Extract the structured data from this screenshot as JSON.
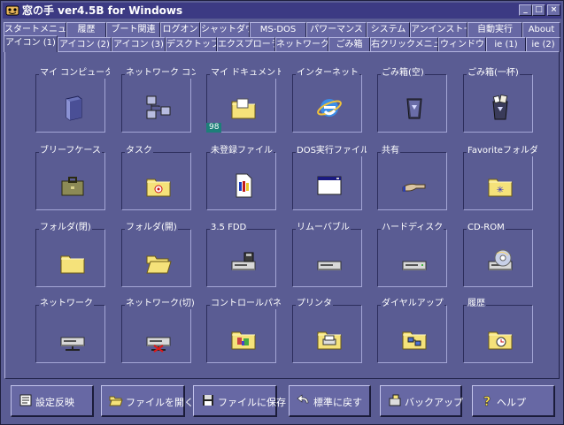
{
  "window": {
    "title": "窓の手 ver4.5B for Windows",
    "controls": [
      "_",
      "□",
      "×"
    ]
  },
  "tabs_row1": [
    "スタートメニュー",
    "履歴",
    "ブート関連",
    "ログオン",
    "シャットダウン",
    "MS-DOS",
    "パワーマンス",
    "システム",
    "アンインストール",
    "自動実行",
    "About"
  ],
  "tabs_row2": [
    "アイコン (1)",
    "アイコン (2)",
    "アイコン (3)",
    "デスクトップ",
    "エクスプローラ",
    "ネットワーク",
    "ごみ箱",
    "右クリックメニュー",
    "ウィンドウ",
    "ie (1)",
    "ie (2)"
  ],
  "active_tab": "アイコン (1)",
  "icons": [
    {
      "label": "マイ コンピュータ",
      "icon": "my-computer-icon"
    },
    {
      "label": "ネットワーク コンピュ",
      "icon": "network-computers-icon"
    },
    {
      "label": "マイ ドキュメント",
      "icon": "my-documents-icon",
      "badge": "98"
    },
    {
      "label": "インターネット",
      "icon": "internet-explorer-icon"
    },
    {
      "label": "ごみ箱(空)",
      "icon": "recycle-bin-empty-icon"
    },
    {
      "label": "ごみ箱(一杯)",
      "icon": "recycle-bin-full-icon"
    },
    {
      "label": "ブリーフケース",
      "icon": "briefcase-icon"
    },
    {
      "label": "タスク",
      "icon": "task-folder-icon"
    },
    {
      "label": "未登録ファイル",
      "icon": "unregistered-file-icon"
    },
    {
      "label": "DOS実行ファイル",
      "icon": "dos-executable-icon"
    },
    {
      "label": "共有",
      "icon": "shared-hand-icon"
    },
    {
      "label": "Favoriteフォルダ",
      "icon": "favorite-folder-icon"
    },
    {
      "label": "フォルダ(閉)",
      "icon": "folder-closed-icon"
    },
    {
      "label": "フォルダ(開)",
      "icon": "folder-open-icon"
    },
    {
      "label": "3.5 FDD",
      "icon": "floppy-drive-icon"
    },
    {
      "label": "リムーバブル",
      "icon": "removable-drive-icon"
    },
    {
      "label": "ハードディスク",
      "icon": "hard-disk-icon"
    },
    {
      "label": "CD-ROM",
      "icon": "cdrom-icon"
    },
    {
      "label": "ネットワーク",
      "icon": "network-drive-icon"
    },
    {
      "label": "ネットワーク(切)",
      "icon": "network-drive-disconnected-icon"
    },
    {
      "label": "コントロールパネル",
      "icon": "control-panel-icon"
    },
    {
      "label": "プリンタ",
      "icon": "printers-folder-icon"
    },
    {
      "label": "ダイヤルアップ",
      "icon": "dialup-folder-icon"
    },
    {
      "label": "履歴",
      "icon": "history-folder-icon"
    }
  ],
  "buttons": [
    {
      "label": "設定反映",
      "icon": "apply-settings-icon"
    },
    {
      "label": "ファイルを開く",
      "icon": "open-folder-icon"
    },
    {
      "label": "ファイルに保存",
      "icon": "floppy-save-icon"
    },
    {
      "label": "標準に戻す",
      "icon": "undo-arrow-icon"
    },
    {
      "label": "バックアップ",
      "icon": "backup-icon"
    },
    {
      "label": "ヘルプ",
      "icon": "help-question-icon"
    }
  ],
  "colors": {
    "background": "#5a5c93",
    "titlebar": "#3c3a83",
    "folder": "#f5e27a",
    "badge": "#1d7f79"
  }
}
